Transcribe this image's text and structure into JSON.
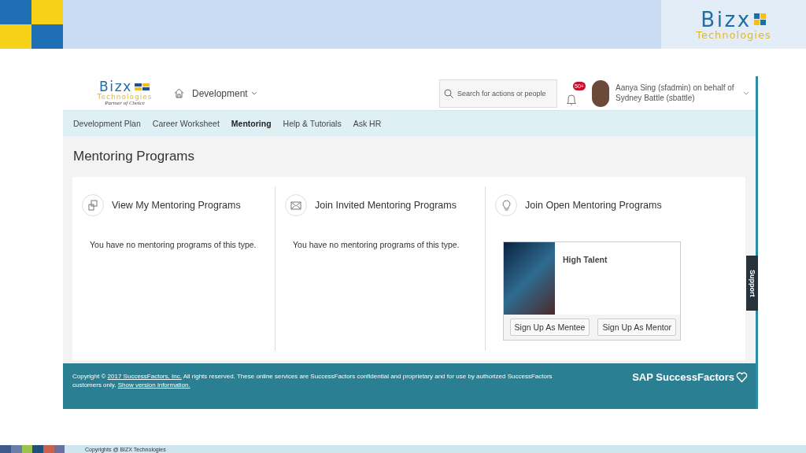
{
  "slide_header": {
    "logo": {
      "name": "Bizx",
      "tagline": "Technologies"
    }
  },
  "app": {
    "header": {
      "logo": {
        "name": "Bizx",
        "tagline": "Technologies",
        "motto": "Partner of Choice"
      },
      "module": "Development",
      "search": {
        "placeholder": "Search for actions or people"
      },
      "notification_count": "50+",
      "user": "Aanya Sing (sfadmin) on behalf of Sydney Battle (sbattle)"
    },
    "tabs": [
      {
        "label": "Development Plan",
        "selected": false
      },
      {
        "label": "Career Worksheet",
        "selected": false
      },
      {
        "label": "Mentoring",
        "selected": true
      },
      {
        "label": "Help & Tutorials",
        "selected": false
      },
      {
        "label": "Ask HR",
        "selected": false
      }
    ],
    "page_title": "Mentoring Programs",
    "sections": [
      {
        "kind": "empty",
        "title": "View My Mentoring Programs",
        "message": "You have no mentoring programs of this type."
      },
      {
        "kind": "empty",
        "title": "Join Invited Mentoring Programs",
        "message": "You have no mentoring programs of this type."
      },
      {
        "kind": "programs",
        "title": "Join Open Mentoring Programs",
        "programs": [
          {
            "name": "High Talent",
            "buttons": [
              "Sign Up As Mentee",
              "Sign Up As Mentor"
            ]
          }
        ]
      }
    ],
    "footer": {
      "copyright_prefix": "Copyright ©",
      "copyright_link": "2017 SuccessFactors, Inc.",
      "copyright_text": "All rights reserved. These online services are SuccessFactors confidential and proprietary and for use by authorized SuccessFactors customers only.",
      "version_link": "Show version information.",
      "brand": "SAP SuccessFactors"
    },
    "support_tab": "Support"
  },
  "slide_footer": {
    "copyright": "Copyrights @ BIZX Technologies"
  }
}
